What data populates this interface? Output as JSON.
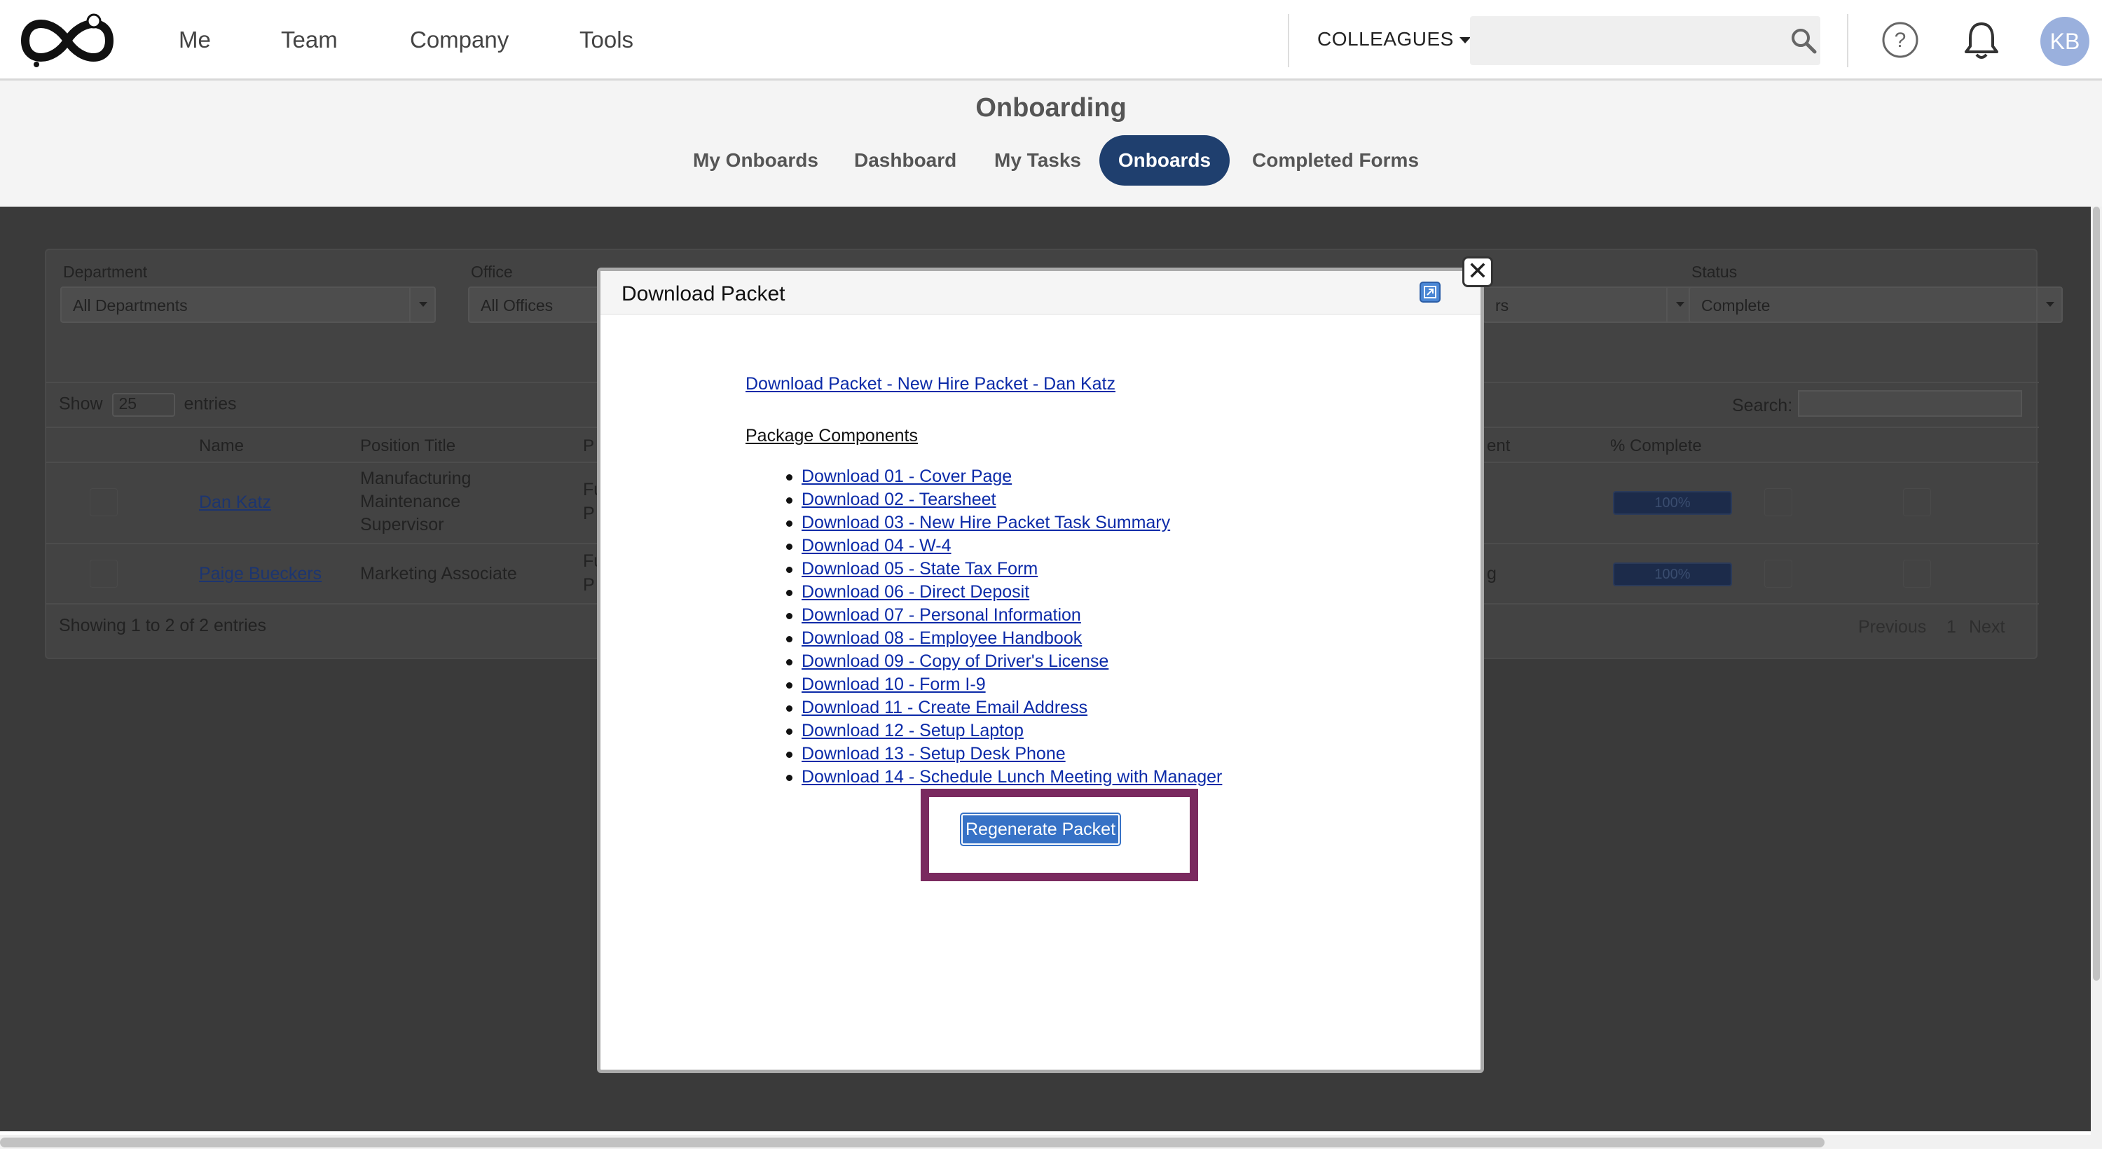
{
  "nav": {
    "items": [
      "Me",
      "Team",
      "Company",
      "Tools"
    ],
    "colleagues_label": "COLLEAGUES",
    "search_placeholder": "",
    "avatar_initials": "KB"
  },
  "subheader": {
    "title": "Onboarding",
    "tabs": [
      {
        "label": "My Onboards",
        "active": false
      },
      {
        "label": "Dashboard",
        "active": false
      },
      {
        "label": "My Tasks",
        "active": false
      },
      {
        "label": "Onboards",
        "active": true
      },
      {
        "label": "Completed Forms",
        "active": false
      }
    ]
  },
  "filters": {
    "department_label": "Department",
    "department_value": "All Departments",
    "office_label": "Office",
    "office_value": "All Offices",
    "partial_value": "rs",
    "status_label": "Status",
    "status_value": "Complete"
  },
  "table": {
    "show_label": "Show",
    "show_value": "25",
    "entries_label": "entries",
    "search_label": "Search:",
    "headers": {
      "name": "Name",
      "position": "Position Title",
      "partial_p": "P",
      "partial_ent": "ent",
      "percent": "% Complete"
    },
    "rows": [
      {
        "name": "Dan Katz",
        "position": "Manufacturing Maintenance Supervisor",
        "p1": "Fu",
        "p2": "P",
        "col4": "",
        "percent": "100%"
      },
      {
        "name": "Paige Bueckers",
        "position": "Marketing Associate",
        "p1": "Fu",
        "p2": "P",
        "col4": "g",
        "percent": "100%"
      }
    ],
    "showing_text": "Showing 1 to 2 of 2 entries",
    "pager": {
      "previous": "Previous",
      "page": "1",
      "next": "Next"
    }
  },
  "modal": {
    "title": "Download Packet",
    "packet_link": "Download Packet - New Hire Packet - Dan Katz",
    "components_title": "Package Components",
    "components": [
      "Download 01 - Cover Page",
      "Download 02 - Tearsheet",
      "Download 03 - New Hire Packet Task Summary",
      "Download 04 - W-4",
      "Download 05 - State Tax Form",
      "Download 06 - Direct Deposit",
      "Download 07 - Personal Information",
      "Download 08 - Employee Handbook",
      "Download 09 - Copy of Driver's License",
      "Download 10 - Form I-9",
      "Download 11 - Create Email Address",
      "Download 12 - Setup Laptop",
      "Download 13 - Setup Desk Phone",
      "Download 14 - Schedule Lunch Meeting with Manager"
    ],
    "regenerate_label": "Regenerate Packet",
    "close_glyph": "✕"
  },
  "colors": {
    "active_tab": "#1f3f6e",
    "link": "#0b2aa8",
    "button": "#3772c6",
    "highlight": "#7a2a5f",
    "avatar": "#9ab0dd"
  }
}
